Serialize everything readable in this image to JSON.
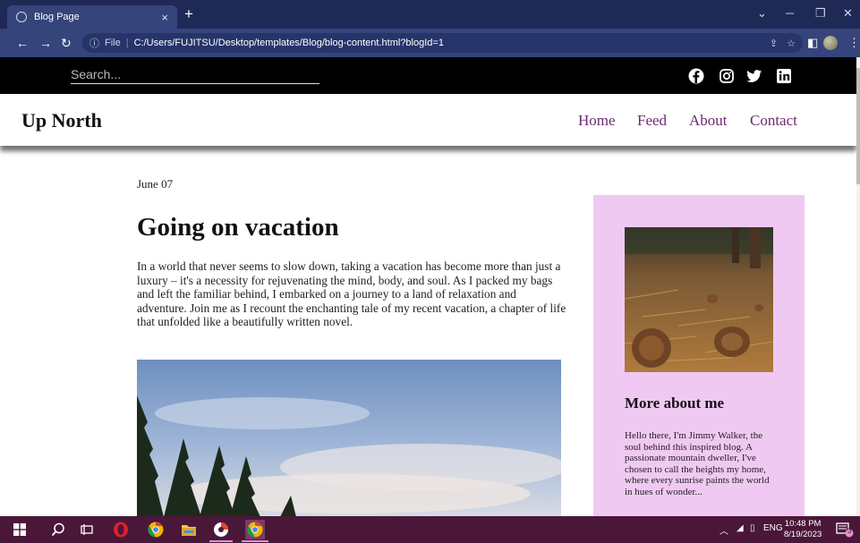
{
  "browser": {
    "tab_title": "Blog Page",
    "tab_close": "×",
    "new_tab": "+",
    "url_prefix": "File",
    "url_path": "C:/Users/FUJITSU/Desktop/templates/Blog/blog-content.html?blogId=1"
  },
  "site": {
    "search_placeholder": "Search...",
    "brand": "Up North",
    "nav": [
      "Home",
      "Feed",
      "About",
      "Contact"
    ]
  },
  "post": {
    "date": "June 07",
    "title": "Going on vacation",
    "body": "In a world that never seems to slow down, taking a vacation has become more than just a luxury – it's a necessity for rejuvenating the mind, body, and soul. As I packed my bags and left the familiar behind, I embarked on a journey to a land of relaxation and adventure. Join me as I recount the enchanting tale of my recent vacation, a chapter of life that unfolded like a beautifully written novel."
  },
  "sidebar": {
    "title": "More about me",
    "body": "Hello there, I'm Jimmy Walker, the soul behind this inspired blog. A passionate mountain dweller, I've chosen to call the heights my home, where every sunrise paints the world in hues of wonder..."
  },
  "taskbar": {
    "lang": "ENG",
    "time": "10:48 PM",
    "date": "8/19/2023",
    "notif_count": "3"
  },
  "colors": {
    "tabbar": "#1e2a55",
    "nav_link": "#6b2a6e",
    "sidebar_bg": "#f0c9f2",
    "taskbar": "#4a1738"
  },
  "icons": [
    "facebook-icon",
    "instagram-icon",
    "twitter-icon",
    "linkedin-icon"
  ]
}
